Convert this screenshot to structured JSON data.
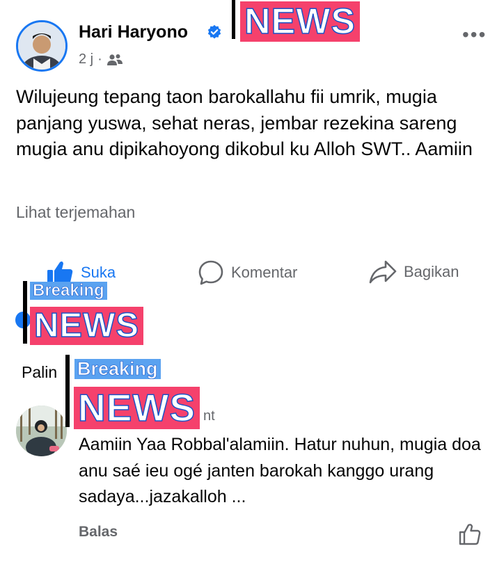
{
  "post": {
    "author": "Hari Haryono",
    "time": "2 j",
    "separator": "·",
    "text": "Wilujeung tepang taon barokallahu fii umrik, mugia panjang yuswa, sehat neras, jembar rezekina sareng mugia anu dipikahoyong dikobul ku Alloh SWT.. Aamiin",
    "translate_link": "Lihat terjemahan",
    "more_glyph": "•••"
  },
  "actions": {
    "like": "Suka",
    "comment": "Komentar",
    "share": "Bagikan"
  },
  "overlays": {
    "news": "NEWS",
    "breaking": "Breaking"
  },
  "comments": {
    "sort_fragment": "Palin",
    "author_fragment": "nt",
    "items": [
      {
        "text": "Aamiin Yaa Robbal'alamiin. Hatur nuhun, mugia doa anu saé ieu ogé janten barokah kanggo urang sadaya...jazakalloh ...",
        "reply": "Balas"
      }
    ]
  },
  "colors": {
    "facebook_blue": "#1877f2",
    "secondary_text": "#65676b",
    "news_pink": "#f5416c",
    "breaking_blue": "#5aa2f0"
  }
}
